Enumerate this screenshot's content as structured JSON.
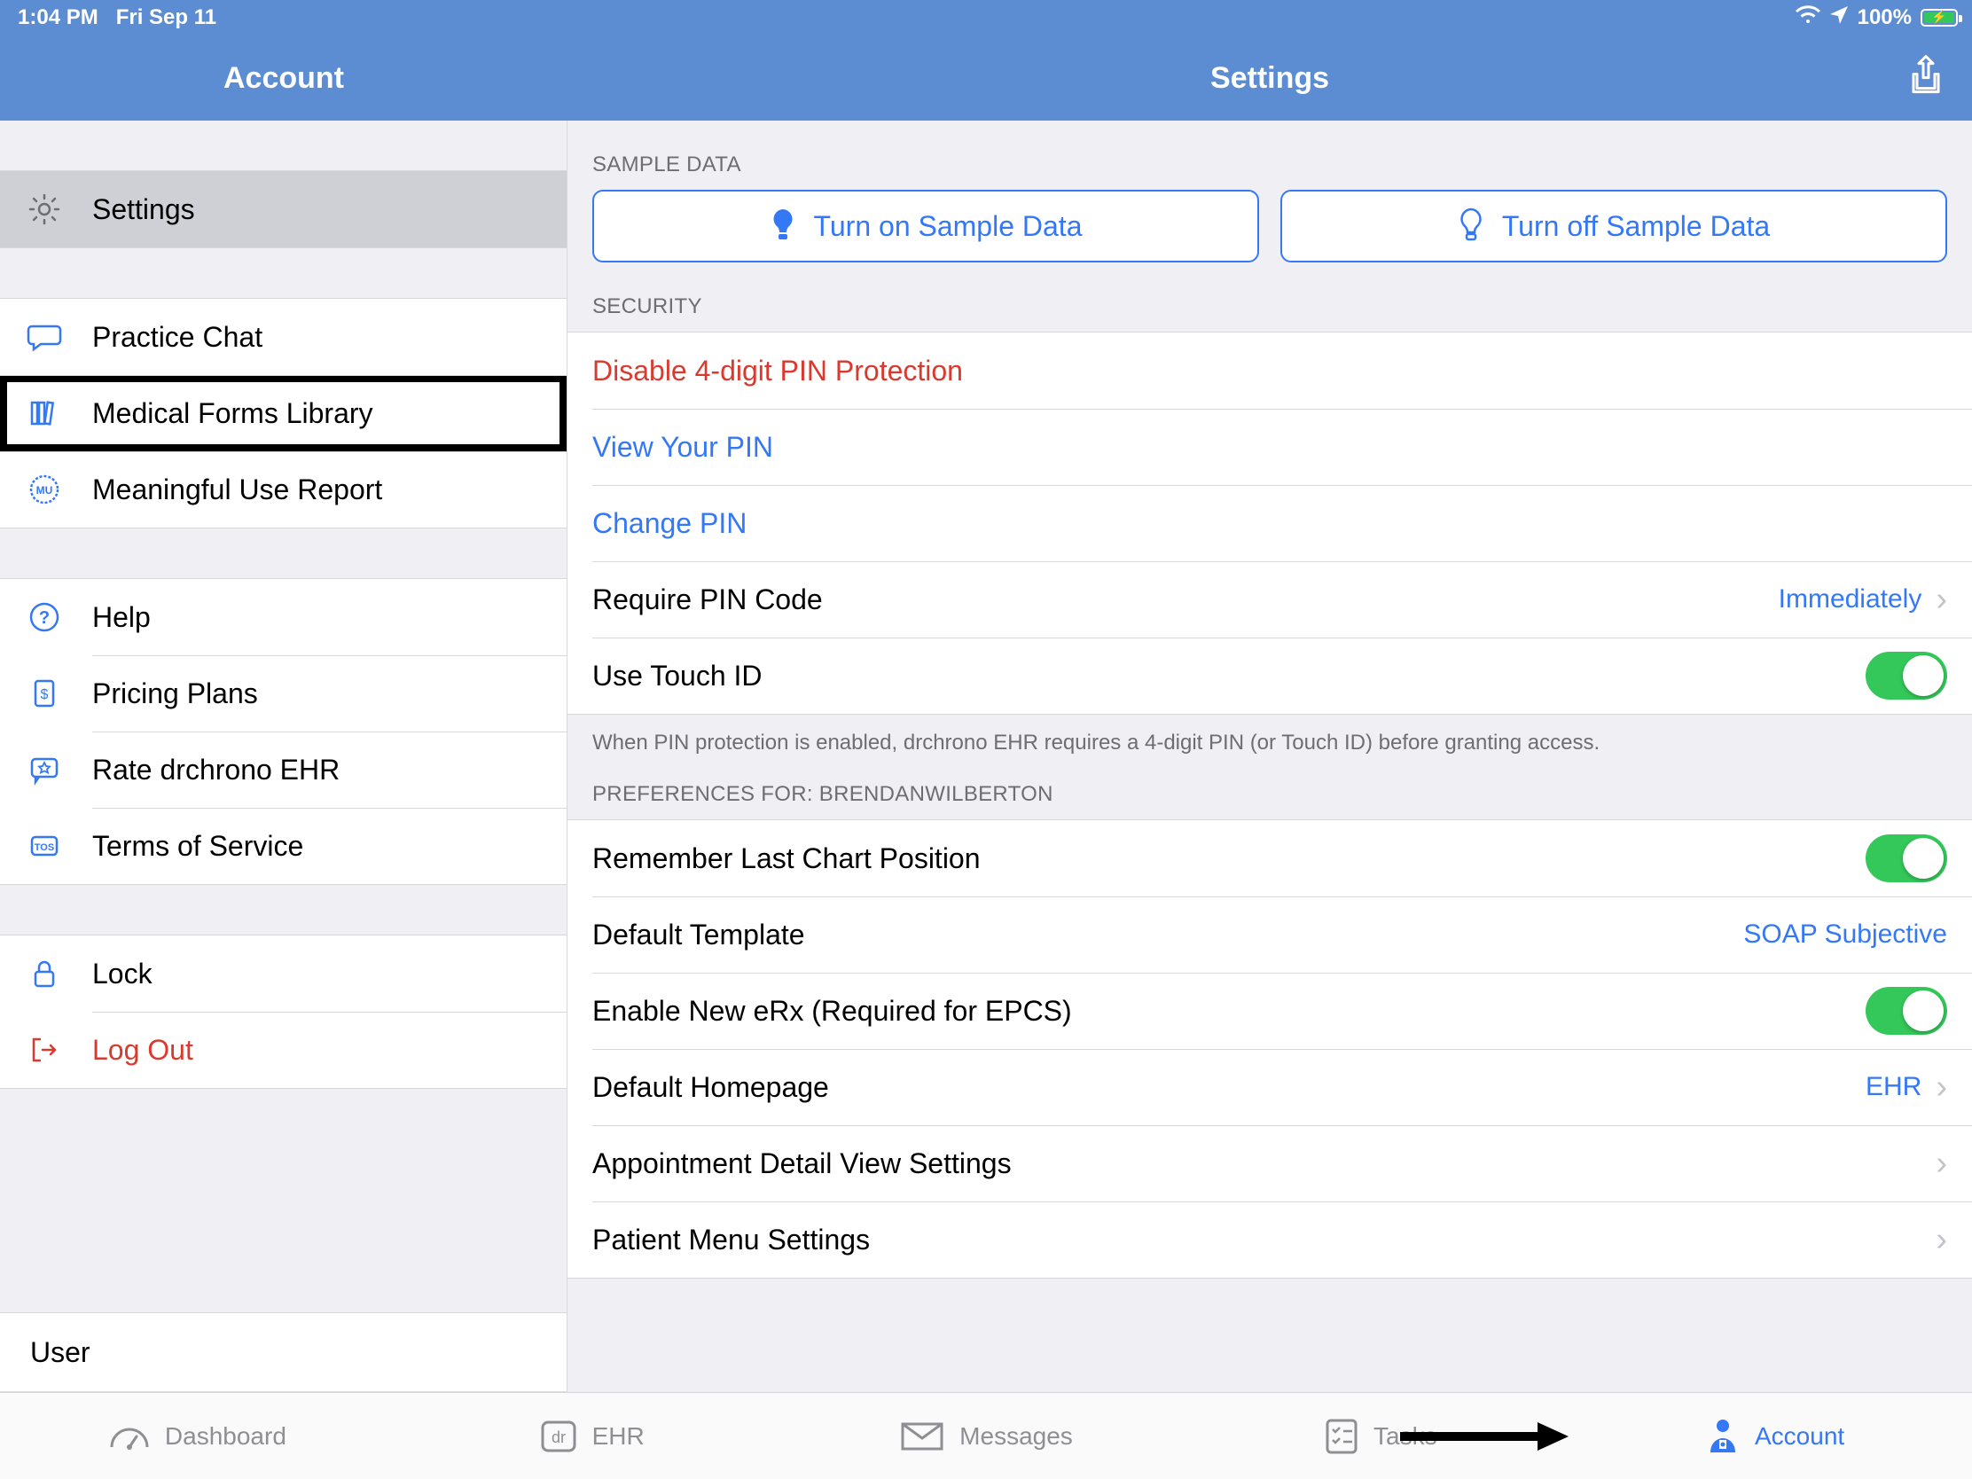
{
  "status": {
    "time": "1:04 PM",
    "date": "Fri Sep 11",
    "battery_pct": "100%"
  },
  "header": {
    "left_title": "Account",
    "right_title": "Settings"
  },
  "sidebar": {
    "items": {
      "settings": "Settings",
      "practice_chat": "Practice Chat",
      "forms_library": "Medical Forms Library",
      "mu_report": "Meaningful Use Report",
      "help": "Help",
      "pricing": "Pricing Plans",
      "rate": "Rate drchrono EHR",
      "tos": "Terms of Service",
      "lock": "Lock",
      "logout": "Log Out"
    },
    "user_label": "User"
  },
  "main": {
    "sample_header": "SAMPLE DATA",
    "sample_on": "Turn on Sample Data",
    "sample_off": "Turn off Sample Data",
    "security_header": "SECURITY",
    "security": {
      "disable_pin": "Disable 4-digit PIN Protection",
      "view_pin": "View Your PIN",
      "change_pin": "Change PIN",
      "require_pin": "Require PIN Code",
      "require_pin_value": "Immediately",
      "touch_id": "Use Touch ID"
    },
    "security_footer": "When PIN protection is enabled, drchrono EHR requires a 4-digit PIN (or Touch ID) before granting access.",
    "prefs_header": "PREFERENCES FOR: BRENDANWILBERTON",
    "prefs": {
      "remember_chart": "Remember Last Chart Position",
      "default_template": "Default Template",
      "default_template_value": "SOAP Subjective",
      "erx": "Enable New eRx (Required for EPCS)",
      "homepage": "Default Homepage",
      "homepage_value": "EHR",
      "appt_detail": "Appointment Detail View Settings",
      "patient_menu": "Patient Menu Settings"
    }
  },
  "tabs": {
    "dashboard": "Dashboard",
    "ehr": "EHR",
    "messages": "Messages",
    "tasks": "Tasks",
    "account": "Account"
  }
}
